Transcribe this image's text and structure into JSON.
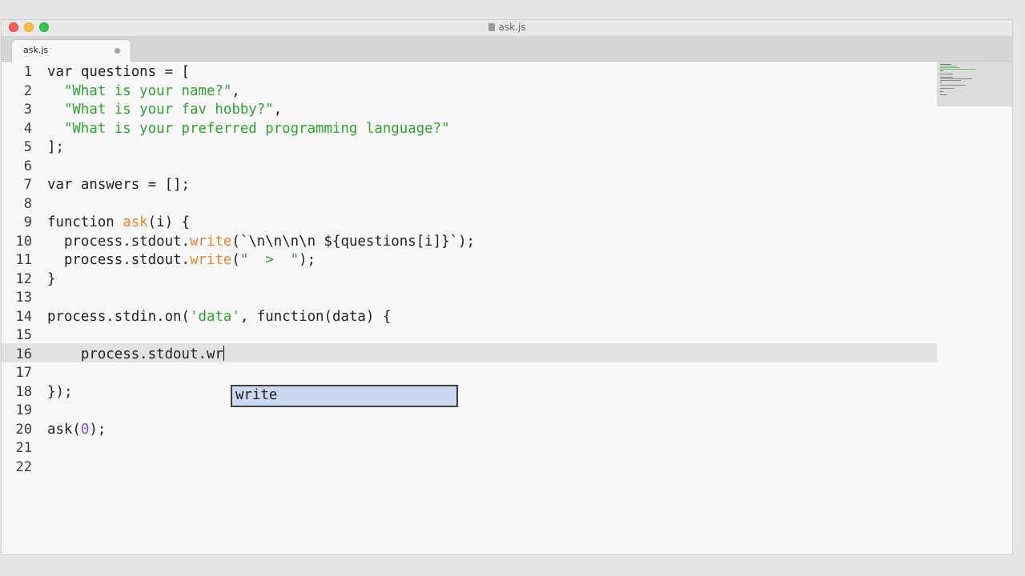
{
  "window": {
    "title": "ask.js"
  },
  "tab": {
    "label": "ask.js"
  },
  "editor": {
    "line_numbers": [
      "1",
      "2",
      "3",
      "4",
      "5",
      "6",
      "7",
      "8",
      "9",
      "10",
      "11",
      "12",
      "13",
      "14",
      "15",
      "16",
      "17",
      "18",
      "19",
      "20",
      "21",
      "22"
    ],
    "code": {
      "l1_a": "var questions = [",
      "l2_s": "\"What is your name?\"",
      "l2_p": ",",
      "l3_s": "\"What is your fav hobby?\"",
      "l3_p": ",",
      "l4_s": "\"What is your preferred programming language?\"",
      "l5_a": "];",
      "l7_a": "var answers = [];",
      "l9_a": "function ",
      "l9_f": "ask",
      "l9_b": "(i) {",
      "l10_a": "process.stdout.",
      "l10_f": "write",
      "l10_b": "(`\\n\\n\\n\\n ${questions[i]}`);",
      "l11_a": "process.stdout.",
      "l11_f": "write",
      "l11_b": "(",
      "l11_s": "\"  >  \"",
      "l11_c": ");",
      "l12_a": "}",
      "l14_a": "process.stdin.on(",
      "l14_s": "'data'",
      "l14_b": ", function(data) {",
      "l16_a": "process.stdout.wr",
      "l18_a": "});",
      "l20_a": "ask(",
      "l20_n": "0",
      "l20_b": ");"
    },
    "current_line": 16
  },
  "autocomplete": {
    "suggestion": "write"
  },
  "colors": {
    "string": "#2ea52e",
    "function_name": "#e6862b",
    "number": "#7b5cd6",
    "current_line": "#e2e2e2",
    "autocomplete_bg": "#c9d7f0"
  }
}
